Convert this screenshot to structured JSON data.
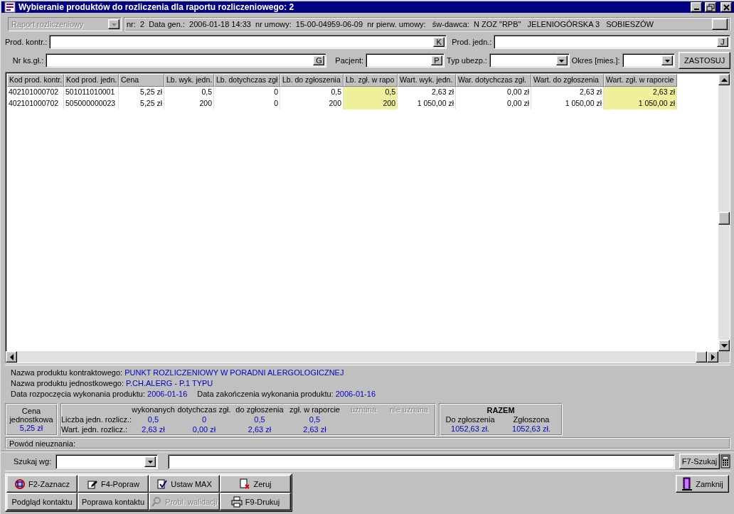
{
  "window": {
    "title": "Wybieranie produktów do rozliczenia dla raportu rozliczeniowego: 2"
  },
  "header": {
    "report_type": {
      "value": "Raport rozliczeniowy",
      "disabled": true
    },
    "info": "nr:  2  Data gen.:  2006-01-18 14:33  nr umowy:  15-00-04959-06-09  nr pierw. umowy:   św-dawca:  N ZOZ \"RPB\"   JELENIOGÓRSKA 3   SOBIESZÓW"
  },
  "filters": [
    {
      "kind": "lookup",
      "label": "Prod. kontr.:",
      "button": "K"
    },
    {
      "kind": "lookup",
      "label": "Prod. jedn.:",
      "button": "J"
    },
    {
      "kind": "lookup",
      "label": "Nr ks.gł.:",
      "button": "G"
    },
    {
      "kind": "lookup",
      "label": "Pacjent:",
      "button": "P"
    },
    {
      "kind": "combo",
      "label": "Typ ubezp.:"
    },
    {
      "kind": "combo",
      "label": "Okres [mies.]:"
    }
  ],
  "apply_button": "ZASTOSUJ",
  "table": {
    "columns": [
      {
        "label": "Kod prod. kontr.",
        "kind": "text",
        "highlighted": false
      },
      {
        "label": "Kod prod. jedn.",
        "kind": "text",
        "highlighted": false
      },
      {
        "label": "Cena",
        "kind": "number",
        "highlighted": false
      },
      {
        "label": "Lb. wyk. jedn.",
        "kind": "number",
        "highlighted": false
      },
      {
        "label": "Lb. dotychczas zgł",
        "kind": "number",
        "highlighted": false
      },
      {
        "label": "Lb. do zgłoszenia",
        "kind": "number",
        "highlighted": false
      },
      {
        "label": "Lb. zgł. w rapo",
        "kind": "number",
        "highlighted": true
      },
      {
        "label": "Wart. wyk. jedn.",
        "kind": "number",
        "highlighted": false
      },
      {
        "label": "War. dotychczas zgł.",
        "kind": "number",
        "highlighted": false
      },
      {
        "label": "Wart. do zgłoszenia",
        "kind": "number",
        "highlighted": false
      },
      {
        "label": "Wart. zgł. w raporcie",
        "kind": "number",
        "highlighted": true
      }
    ],
    "rows": [
      [
        "402101000702",
        "501011010001",
        "5,25 zł",
        "0,5",
        "0",
        "0,5",
        "0,5",
        "2,63 zł",
        "0,00 zł",
        "2,63 zł",
        "2,63 zł"
      ],
      [
        "402101000702",
        "505000000023",
        "5,25 zł",
        "200",
        "0",
        "200",
        "200",
        "1 050,00 zł",
        "0,00 zł",
        "1 050,00 zł",
        "1 050,00 zł"
      ]
    ]
  },
  "details": [
    [
      {
        "label": "Nazwa produktu kontraktowego:",
        "value": "PUNKT ROZLICZENIOWY W PORADNI ALERGOLOGICZNEJ"
      }
    ],
    [
      {
        "label": "Nazwa produktu jednostkowego:",
        "value": "P.CH.ALERG - P.1 TYPU"
      }
    ],
    [
      {
        "label": "Data rozpoczęcia wykonania produktu:",
        "value": "2006-01-16"
      },
      {
        "label": "Data zakończenia wykonania produktu:",
        "value": "2006-01-16"
      }
    ]
  ],
  "summary": {
    "unit_price": {
      "label": "Cena jednostkowa",
      "value": "5,25 zł"
    },
    "columns": [
      {
        "label": "wykonanych",
        "disabled": false
      },
      {
        "label": "dotychczas zgł.",
        "disabled": false
      },
      {
        "label": "do zgłoszenia",
        "disabled": false
      },
      {
        "label": "zgł. w raporcie",
        "disabled": false
      },
      {
        "label": "uznana",
        "disabled": true
      },
      {
        "label": "nie uznana",
        "disabled": true
      }
    ],
    "rows": [
      {
        "label": "Liczba jedn. rozlicz.:",
        "values": [
          "0,5",
          "0",
          "0,5",
          "0,5"
        ]
      },
      {
        "label": "Wart. jedn. rozlicz.:",
        "values": [
          "2,63 zł",
          "0,00 zł",
          "2,63 zł",
          "2,63 zł"
        ]
      }
    ],
    "totals": {
      "title": "RAZEM",
      "items": [
        {
          "label": "Do zgłoszenia",
          "value": "1052,63 zł."
        },
        {
          "label": "Zgłoszona",
          "value": "1052,63 zł."
        }
      ]
    }
  },
  "rejection": {
    "label": "Powód nieuznania:"
  },
  "search": {
    "label": "Szukaj wg:",
    "button": "F7-Szukaj"
  },
  "actions": {
    "rows": [
      [
        {
          "label": "F2-Zaznacz",
          "disabled": false
        },
        {
          "label": "F4-Popraw",
          "disabled": false
        },
        {
          "label": "Ustaw MAX",
          "disabled": false
        },
        {
          "label": "Zeruj",
          "disabled": false
        }
      ],
      [
        {
          "label": "Podgląd kontaktu",
          "disabled": false
        },
        {
          "label": "Poprawa kontaktu",
          "disabled": false
        },
        {
          "label": "Probl. walidacji",
          "disabled": true
        },
        {
          "label": "F9-Drukuj",
          "disabled": false
        }
      ]
    ],
    "close": "Zamknij"
  }
}
